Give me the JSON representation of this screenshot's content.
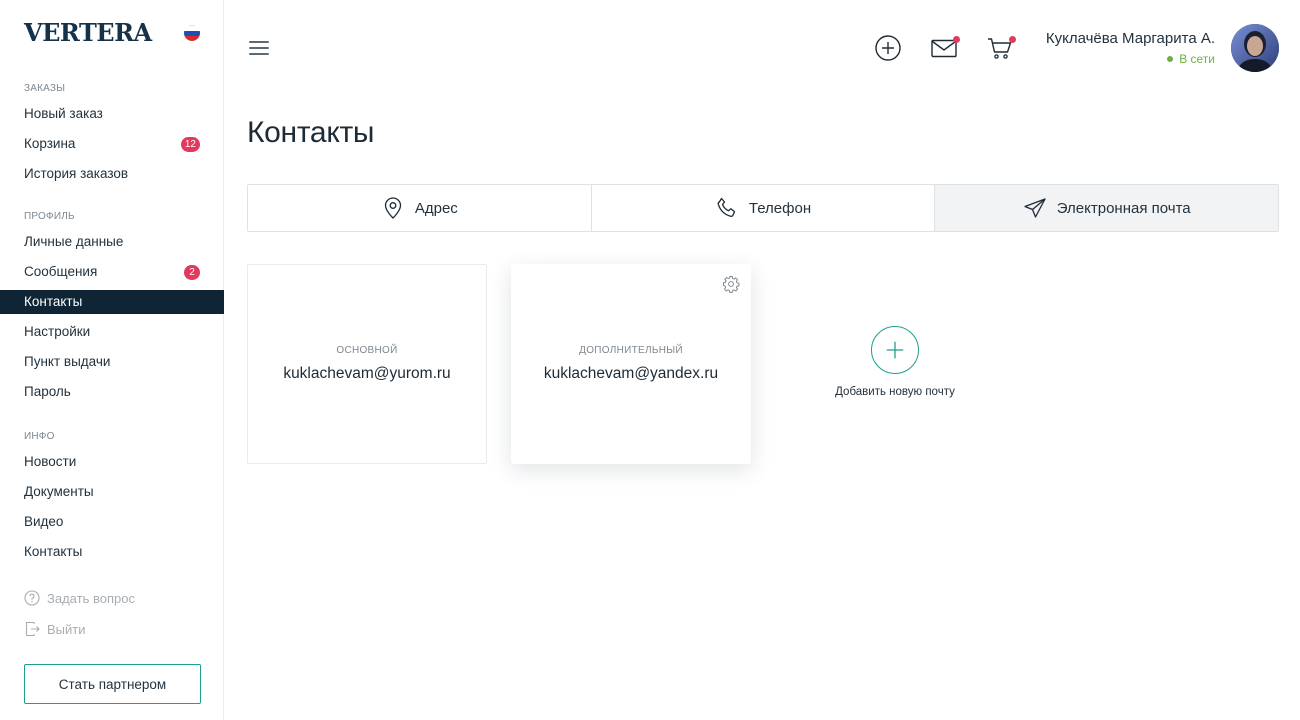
{
  "app": {
    "logo": "VERTERA",
    "flag_colors": [
      "#ffffff",
      "#1f4fb5",
      "#d92b2b"
    ]
  },
  "sidebar": {
    "sections": [
      {
        "title": "Заказы",
        "items": [
          {
            "label": "Новый заказ"
          },
          {
            "label": "Корзина",
            "badge": "12"
          },
          {
            "label": "История заказов"
          }
        ]
      },
      {
        "title": "Профиль",
        "items": [
          {
            "label": "Личные данные"
          },
          {
            "label": "Сообщения",
            "badge": "2"
          },
          {
            "label": "Контакты",
            "active": true
          },
          {
            "label": "Настройки"
          },
          {
            "label": "Пункт выдачи"
          },
          {
            "label": "Пароль"
          }
        ]
      },
      {
        "title": "Инфо",
        "items": [
          {
            "label": "Новости"
          },
          {
            "label": "Документы"
          },
          {
            "label": "Видео"
          },
          {
            "label": "Контакты"
          }
        ]
      }
    ],
    "ask_question": "Задать вопрос",
    "logout": "Выйти",
    "partner_button": "Стать партнером"
  },
  "header": {
    "icons": [
      "add-circle-icon",
      "mail-icon",
      "cart-icon"
    ],
    "user_name": "Куклачёва Маргарита А.",
    "user_status": "В сети"
  },
  "main": {
    "title": "Контакты",
    "tabs": [
      {
        "label": "Адрес",
        "icon": "location-pin-icon"
      },
      {
        "label": "Телефон",
        "icon": "phone-icon"
      },
      {
        "label": "Электронная почта",
        "icon": "paper-plane-icon",
        "active": true
      }
    ],
    "emails": [
      {
        "type": "основной",
        "email": "kuklachevam@yurom.ru"
      },
      {
        "type": "дополнительный",
        "email": "kuklachevam@yandex.ru"
      }
    ],
    "add_label": "Добавить новую почту"
  },
  "colors": {
    "accent": "#1e9e8c",
    "dark_nav": "#0f2536",
    "badge": "#e2395c",
    "online": "#6fb13f"
  }
}
